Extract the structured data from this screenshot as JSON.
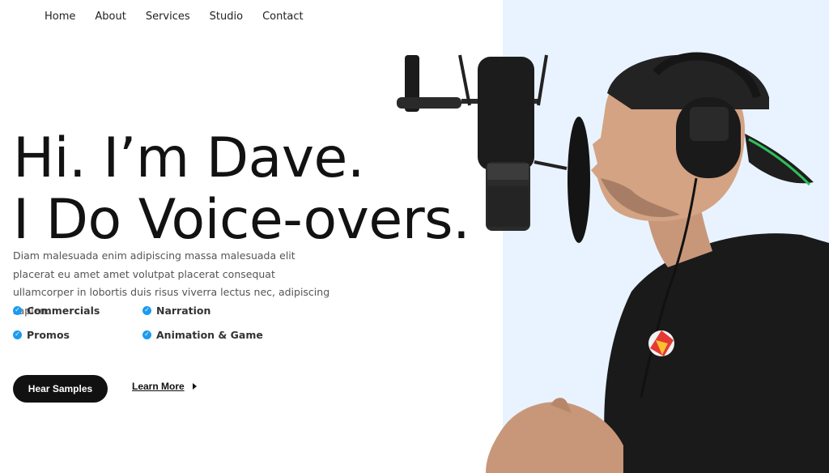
{
  "nav": {
    "items": [
      "Home",
      "About",
      "Services",
      "Studio",
      "Contact"
    ]
  },
  "hero": {
    "headline_line1": "Hi. I’m Dave.",
    "headline_line2": "I Do Voice-overs.",
    "description": "Diam malesuada enim adipiscing massa malesuada elit placerat eu amet amet volutpat placerat consequat ullamcorper in lobortis duis risus viverra lectus nec, adipiscing sapien.",
    "features": [
      "Commercials",
      "Narration",
      "Promos",
      "Animation & Game"
    ],
    "primary_button": "Hear Samples",
    "secondary_button": "Learn More"
  },
  "colors": {
    "accent": "#1a9bf0",
    "panel": "#e8f3ff",
    "button": "#111111"
  },
  "icons": {
    "check": "check-circle-icon",
    "arrow": "caret-right-icon"
  }
}
